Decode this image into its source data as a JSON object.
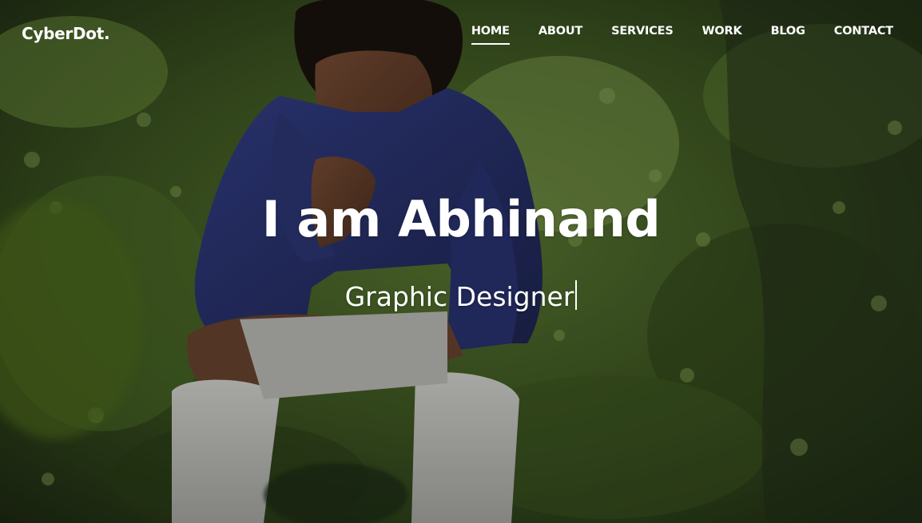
{
  "brand": {
    "name": "CyberDot."
  },
  "nav": {
    "items": [
      {
        "label": "HOME",
        "active": true
      },
      {
        "label": "ABOUT",
        "active": false
      },
      {
        "label": "SERVICES",
        "active": false
      },
      {
        "label": "WORK",
        "active": false
      },
      {
        "label": "BLOG",
        "active": false
      },
      {
        "label": "CONTACT",
        "active": false
      }
    ]
  },
  "hero": {
    "headline": "I am Abhinand",
    "subline": "Graphic Designer",
    "background_image": "photo-young-man-sitting-in-forest",
    "colors": {
      "text": "#ffffff",
      "foliage": "#3f5a22",
      "shirt": "#2b3470",
      "pants": "#c9c9c6"
    }
  }
}
